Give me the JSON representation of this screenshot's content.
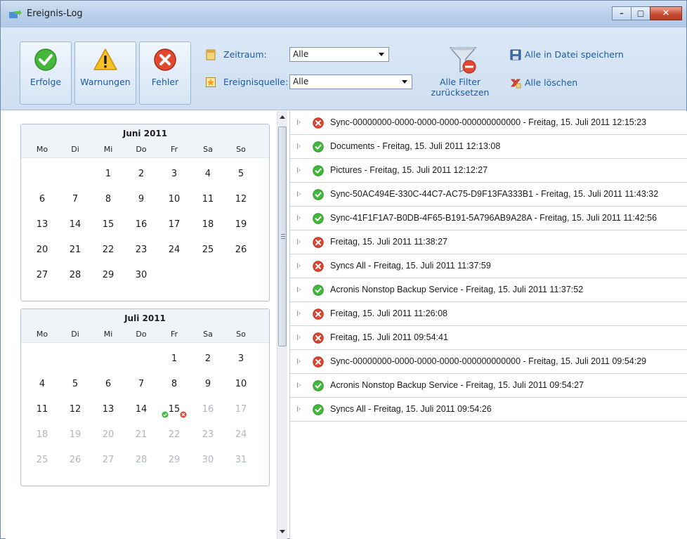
{
  "window": {
    "title": "Ereignis-Log"
  },
  "toolbar": {
    "success_label": "Erfolge",
    "warnings_label": "Warnungen",
    "errors_label": "Fehler",
    "period_label": "Zeitraum:",
    "period_value": "Alle",
    "source_label": "Ereignisquelle:",
    "source_value": "Alle",
    "reset_label_1": "Alle Filter",
    "reset_label_2": "zurücksetzen",
    "save_label": "Alle in Datei speichern",
    "delete_label": "Alle löschen"
  },
  "calendars": [
    {
      "title": "Juni 2011",
      "weekdays": [
        "Mo",
        "Di",
        "Mi",
        "Do",
        "Fr",
        "Sa",
        "So"
      ],
      "weeks": [
        [
          "",
          "",
          "1",
          "2",
          "3",
          "4",
          "5"
        ],
        [
          "6",
          "7",
          "8",
          "9",
          "10",
          "11",
          "12"
        ],
        [
          "13",
          "14",
          "15",
          "16",
          "17",
          "18",
          "19"
        ],
        [
          "20",
          "21",
          "22",
          "23",
          "24",
          "25",
          "26"
        ],
        [
          "27",
          "28",
          "29",
          "30",
          "",
          "",
          ""
        ]
      ]
    },
    {
      "title": "Juli 2011",
      "weekdays": [
        "Mo",
        "Di",
        "Mi",
        "Do",
        "Fr",
        "Sa",
        "So"
      ],
      "weeks": [
        [
          "",
          "",
          "",
          "",
          "1",
          "2",
          "3"
        ],
        [
          "4",
          "5",
          "6",
          "7",
          "8",
          "9",
          "10"
        ],
        [
          "11",
          "12",
          "13",
          "14",
          "15",
          "16",
          "17"
        ],
        [
          "18",
          "19",
          "20",
          "21",
          "22",
          "23",
          "24"
        ],
        [
          "25",
          "26",
          "27",
          "28",
          "29",
          "30",
          "31"
        ]
      ],
      "highlight_day": "15"
    }
  ],
  "events": [
    {
      "status": "error",
      "text": "Sync-00000000-0000-0000-0000-000000000000 - Freitag, 15. Juli 2011 12:15:23"
    },
    {
      "status": "success",
      "text": "Documents - Freitag, 15. Juli 2011 12:13:08"
    },
    {
      "status": "success",
      "text": "Pictures - Freitag, 15. Juli 2011 12:12:27"
    },
    {
      "status": "success",
      "text": "Sync-50AC494E-330C-44C7-AC75-D9F13FA333B1 - Freitag, 15. Juli 2011 11:43:32"
    },
    {
      "status": "success",
      "text": "Sync-41F1F1A7-B0DB-4F65-B191-5A796AB9A28A - Freitag, 15. Juli 2011 11:42:56"
    },
    {
      "status": "error",
      "text": "Freitag, 15. Juli 2011 11:38:27"
    },
    {
      "status": "error",
      "text": "Syncs All - Freitag, 15. Juli 2011 11:37:59"
    },
    {
      "status": "success",
      "text": "Acronis Nonstop Backup Service - Freitag, 15. Juli 2011 11:37:52"
    },
    {
      "status": "error",
      "text": "Freitag, 15. Juli 2011 11:26:08"
    },
    {
      "status": "error",
      "text": "Freitag, 15. Juli 2011 09:54:41"
    },
    {
      "status": "error",
      "text": "Sync-00000000-0000-0000-0000-000000000000 - Freitag, 15. Juli 2011 09:54:29"
    },
    {
      "status": "success",
      "text": "Acronis Nonstop Backup Service - Freitag, 15. Juli 2011 09:54:27"
    },
    {
      "status": "success",
      "text": "Syncs All - Freitag, 15. Juli 2011 09:54:26"
    }
  ],
  "colors": {
    "accent": "#1a5aa8",
    "success": "#3fb93a",
    "error": "#e0442f",
    "warning": "#f2b61d"
  }
}
